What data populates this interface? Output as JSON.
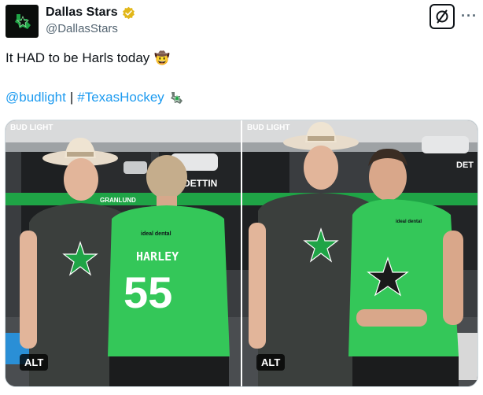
{
  "author": {
    "display_name": "Dallas Stars",
    "handle": "@DallasStars",
    "verified": true,
    "avatar_icon": "dallas-stars-logo-icon"
  },
  "actions": {
    "grok_icon": "grok-icon",
    "more_label": "···"
  },
  "tweet": {
    "text": "It HAD to be Harls today",
    "emoji": "🤠",
    "mention": "@budlight",
    "separator": "|",
    "hashtag": "#TexasHockey",
    "hashtag_icon": "texas-stars-emoji-icon"
  },
  "media": {
    "photos": [
      {
        "alt_label": "ALT",
        "jersey_name": "HARLEY",
        "jersey_number": "55",
        "sponsor": "ideal dental",
        "locker_nameplates": [
          "GRANLUND",
          "DETTIN"
        ],
        "bud_light": "BUD LIGHT"
      },
      {
        "alt_label": "ALT",
        "sponsor": "ideal dental",
        "locker_nameplates": [
          "DET"
        ],
        "bud_light": "BUD LIGHT"
      }
    ]
  },
  "colors": {
    "link": "#1d9bf0",
    "stars_green": "#22b14c",
    "verified_gold": "#e2b719"
  }
}
